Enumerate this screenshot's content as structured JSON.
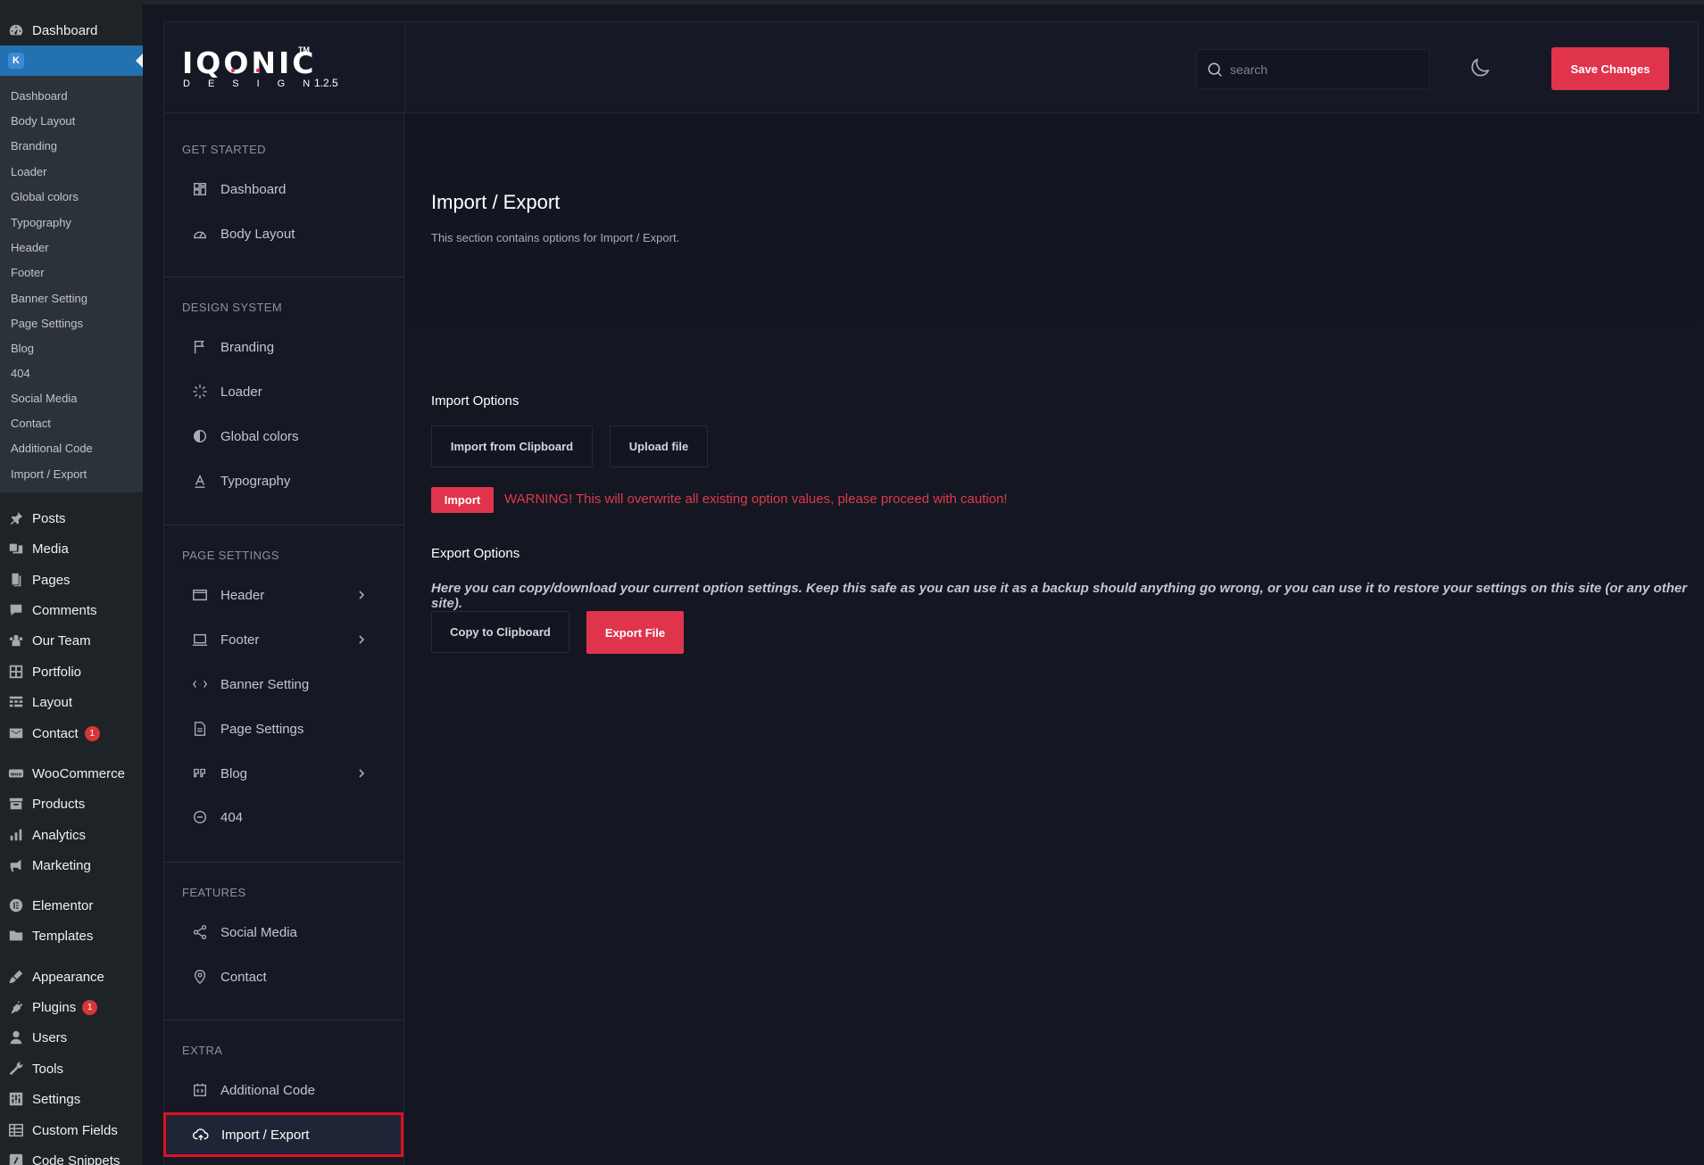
{
  "wp_menu": {
    "dashboard": "Dashboard",
    "active_badge": "K",
    "submenu": [
      "Dashboard",
      "Body Layout",
      "Branding",
      "Loader",
      "Global colors",
      "Typography",
      "Header",
      "Footer",
      "Banner Setting",
      "Page Settings",
      "Blog",
      "404",
      "Social Media",
      "Contact",
      "Additional Code",
      "Import / Export"
    ],
    "items": [
      {
        "label": "Posts",
        "icon": "pin-icon"
      },
      {
        "label": "Media",
        "icon": "media-icon"
      },
      {
        "label": "Pages",
        "icon": "pages-icon"
      },
      {
        "label": "Comments",
        "icon": "comment-icon"
      },
      {
        "label": "Our Team",
        "icon": "team-icon"
      },
      {
        "label": "Portfolio",
        "icon": "grid-icon"
      },
      {
        "label": "Layout",
        "icon": "layout-icon"
      },
      {
        "label": "Contact",
        "icon": "mail-icon",
        "badge": "1"
      },
      {
        "label": "WooCommerce",
        "icon": "woo-icon"
      },
      {
        "label": "Products",
        "icon": "archive-icon"
      },
      {
        "label": "Analytics",
        "icon": "chart-icon"
      },
      {
        "label": "Marketing",
        "icon": "megaphone-icon"
      },
      {
        "label": "Elementor",
        "icon": "elementor-icon"
      },
      {
        "label": "Templates",
        "icon": "folder-icon"
      },
      {
        "label": "Appearance",
        "icon": "brush-icon"
      },
      {
        "label": "Plugins",
        "icon": "plugin-icon",
        "badge": "1"
      },
      {
        "label": "Users",
        "icon": "user-icon"
      },
      {
        "label": "Tools",
        "icon": "wrench-icon"
      },
      {
        "label": "Settings",
        "icon": "settings-icon"
      },
      {
        "label": "Custom Fields",
        "icon": "fields-icon"
      },
      {
        "label": "Code Snippets",
        "icon": "code-icon"
      }
    ]
  },
  "header": {
    "logo_word": "IQONIC",
    "logo_tm": "TM",
    "logo_sub": "DESIGN",
    "version": "1.2.5",
    "search_placeholder": "search",
    "save_label": "Save Changes"
  },
  "sidenav": {
    "groups": [
      {
        "title": "GET STARTED",
        "items": [
          "Dashboard",
          "Body Layout"
        ]
      },
      {
        "title": "DESIGN SYSTEM",
        "items": [
          "Branding",
          "Loader",
          "Global colors",
          "Typography"
        ]
      },
      {
        "title": "PAGE SETTINGS",
        "items": [
          "Header",
          "Footer",
          "Banner Setting",
          "Page Settings",
          "Blog",
          "404"
        ]
      },
      {
        "title": "FEATURES",
        "items": [
          "Social Media",
          "Contact"
        ]
      },
      {
        "title": "EXTRA",
        "items": [
          "Additional Code",
          "Import / Export"
        ]
      }
    ]
  },
  "main": {
    "title": "Import / Export",
    "description": "This section contains options for Import / Export.",
    "import": {
      "title": "Import Options",
      "clipboard_label": "Import from Clipboard",
      "upload_label": "Upload file",
      "import_label": "Import",
      "warning": "WARNING! This will overwrite all existing option values, please proceed with caution!"
    },
    "export": {
      "title": "Export Options",
      "description": "Here you can copy/download your current option settings. Keep this safe as you can use it as a backup should anything go wrong, or you can use it to restore your settings on this site (or any other site).",
      "copy_label": "Copy to Clipboard",
      "file_label": "Export File"
    }
  },
  "colors": {
    "accent": "#e0344d",
    "wp_active": "#2271b1",
    "highlight_border": "#e0111d"
  }
}
